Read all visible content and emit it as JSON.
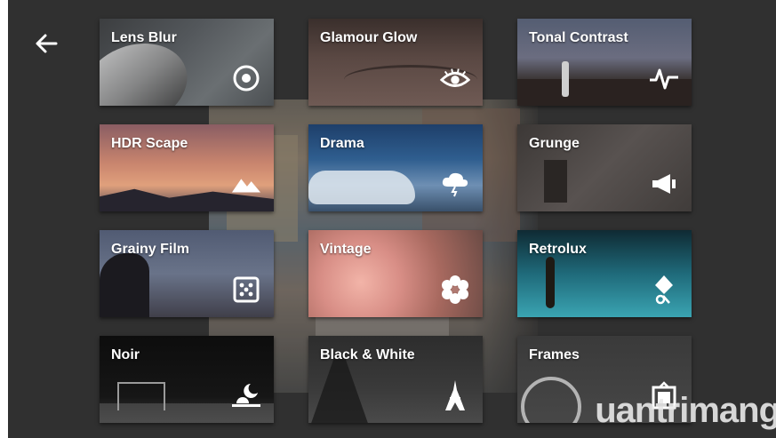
{
  "navigation": {
    "back_icon": "arrow-left-icon"
  },
  "filters": [
    {
      "label": "Lens Blur",
      "icon": "target-icon"
    },
    {
      "label": "Glamour Glow",
      "icon": "eye-icon"
    },
    {
      "label": "Tonal Contrast",
      "icon": "pulse-icon"
    },
    {
      "label": "HDR Scape",
      "icon": "mountains-icon"
    },
    {
      "label": "Drama",
      "icon": "storm-cloud-icon"
    },
    {
      "label": "Grunge",
      "icon": "megaphone-icon"
    },
    {
      "label": "Grainy Film",
      "icon": "dice-icon"
    },
    {
      "label": "Vintage",
      "icon": "flower-icon"
    },
    {
      "label": "Retrolux",
      "icon": "pin-icon"
    },
    {
      "label": "Noir",
      "icon": "moon-sunset-icon"
    },
    {
      "label": "Black & White",
      "icon": "eiffel-tower-icon"
    },
    {
      "label": "Frames",
      "icon": "frame-icon"
    }
  ],
  "watermark": {
    "text": "uantrimang"
  }
}
